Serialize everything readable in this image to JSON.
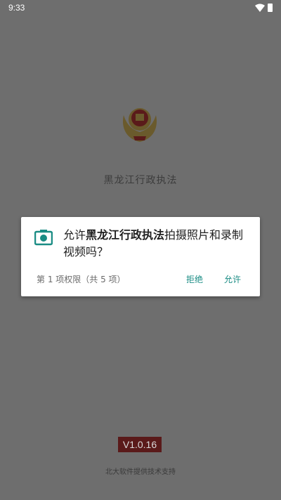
{
  "status_bar": {
    "time": "9:33"
  },
  "app": {
    "title": "黑龙江行政执法",
    "version": "V1.0.16",
    "support_text": "北大软件提供技术支持"
  },
  "permission_dialog": {
    "message_prefix": "允许",
    "app_name": "黑龙江行政执法",
    "message_suffix": "拍摄照片和录制视频吗？",
    "counter": "第 1 项权限（共 5 项）",
    "deny_label": "拒绝",
    "allow_label": "允许",
    "icon": "camera-icon",
    "accent_color": "#1a8c84"
  }
}
